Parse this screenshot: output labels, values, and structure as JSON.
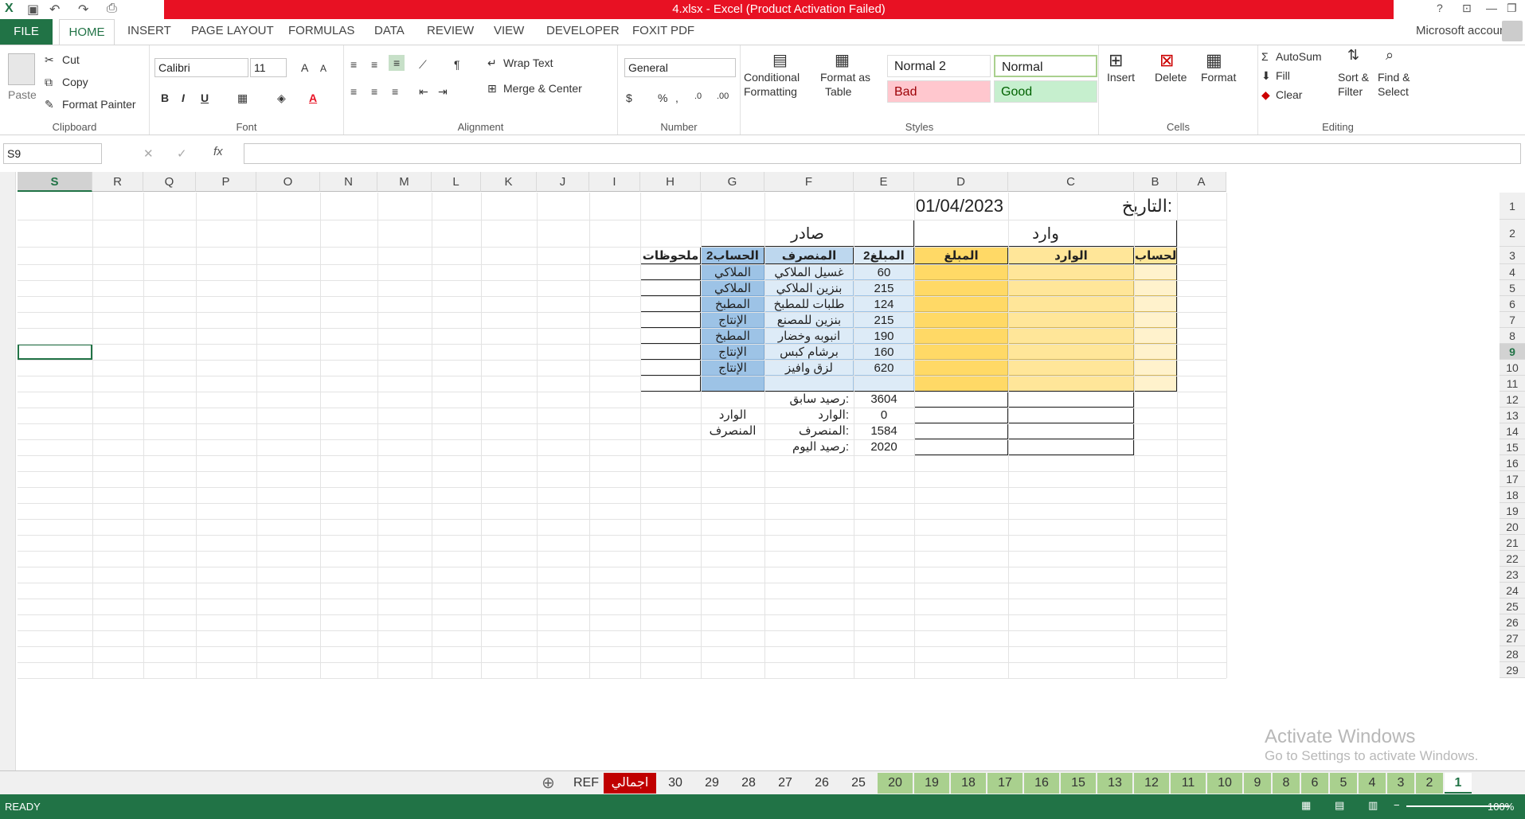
{
  "window": {
    "title": "4.xlsx -  Excel (Product Activation Failed)",
    "account": "Microsoft account",
    "help": "?"
  },
  "tabs": [
    "FILE",
    "HOME",
    "INSERT",
    "PAGE LAYOUT",
    "FORMULAS",
    "DATA",
    "REVIEW",
    "VIEW",
    "DEVELOPER",
    "FOXIT PDF"
  ],
  "ribbon": {
    "clipboard": {
      "paste": "Paste",
      "cut": "Cut",
      "copy": "Copy",
      "format_painter": "Format Painter",
      "label": "Clipboard"
    },
    "font": {
      "name": "Calibri",
      "size": "11",
      "label": "Font"
    },
    "alignment": {
      "wrap": "Wrap Text",
      "merge": "Merge & Center",
      "label": "Alignment"
    },
    "number": {
      "format": "General",
      "label": "Number"
    },
    "styles": {
      "cond": "Conditional",
      "cond2": "Formatting",
      "fmt": "Format as",
      "fmt2": "Table",
      "normal2": "Normal 2",
      "normal": "Normal",
      "bad": "Bad",
      "good": "Good",
      "label": "Styles"
    },
    "cells": {
      "insert": "Insert",
      "delete": "Delete",
      "format": "Format",
      "label": "Cells"
    },
    "editing": {
      "autosum": "AutoSum",
      "fill": "Fill",
      "clear": "Clear",
      "sort": "Sort &",
      "sort2": "Filter",
      "find": "Find &",
      "find2": "Select",
      "label": "Editing"
    }
  },
  "formula_bar": {
    "name_box": "S9",
    "fx": "fx",
    "content": ""
  },
  "columns": [
    "S",
    "R",
    "Q",
    "P",
    "O",
    "N",
    "M",
    "L",
    "K",
    "J",
    "I",
    "H",
    "G",
    "F",
    "E",
    "D",
    "C",
    "B",
    "A"
  ],
  "rows": [
    "1",
    "2",
    "3",
    "4",
    "5",
    "6",
    "7",
    "8",
    "9",
    "10",
    "11",
    "12",
    "13",
    "14",
    "15",
    "16",
    "17",
    "18",
    "19",
    "20",
    "21",
    "22",
    "23",
    "24",
    "25",
    "26",
    "27",
    "28",
    "29"
  ],
  "sheet": {
    "date_label": "التاريخ:",
    "date_value": "01/04/2023",
    "incoming_header": "وارد",
    "outgoing_header": "صادر",
    "headers": {
      "account": "الحساب",
      "incoming": "الوارد",
      "amount": "المبلغ",
      "amount2": "المبلغ2",
      "expense": "المنصرف",
      "account2": "الحساب2",
      "notes": "ملحوظات"
    },
    "rows": [
      {
        "amount2": "60",
        "expense": "غسيل الملاكي",
        "account2": "الملاكي"
      },
      {
        "amount2": "215",
        "expense": "بنزين الملاكي",
        "account2": "الملاكي"
      },
      {
        "amount2": "124",
        "expense": "طلبات للمطبخ",
        "account2": "المطبخ"
      },
      {
        "amount2": "215",
        "expense": "بنزين للمصنع",
        "account2": "الإنتاج"
      },
      {
        "amount2": "190",
        "expense": "انبوبه وخضار",
        "account2": "المطبخ"
      },
      {
        "amount2": "160",
        "expense": "برشام كبس",
        "account2": "الإنتاج"
      },
      {
        "amount2": "620",
        "expense": "لزق وافيز",
        "account2": "الإنتاج"
      }
    ],
    "summary": [
      {
        "label": "رصيد سابق:",
        "value": "3604",
        "side": ""
      },
      {
        "label": "الوارد:",
        "value": "0",
        "side": "الوارد"
      },
      {
        "label": "المنصرف:",
        "value": "1584",
        "side": "المنصرف"
      },
      {
        "label": "رصيد اليوم:",
        "value": "2020",
        "side": ""
      }
    ]
  },
  "sheet_tabs": [
    "REF",
    "اجمالي",
    "30",
    "29",
    "28",
    "27",
    "26",
    "25",
    "20",
    "19",
    "18",
    "17",
    "16",
    "15",
    "13",
    "12",
    "11",
    "10",
    "9",
    "8",
    "6",
    "5",
    "4",
    "3",
    "2",
    "1"
  ],
  "status": {
    "ready": "READY",
    "zoom": "100%"
  },
  "watermark": {
    "activate": "Activate Windows",
    "settings": "Go to Settings to activate Windows."
  },
  "colors": {
    "excel_green": "#217346",
    "title_red": "#e81123",
    "header_blue": "#9dc3e6",
    "cell_blue": "#ddebf7",
    "gold": "#ffd966",
    "gold_light": "#ffe699",
    "gold_pale": "#fff2cc"
  }
}
